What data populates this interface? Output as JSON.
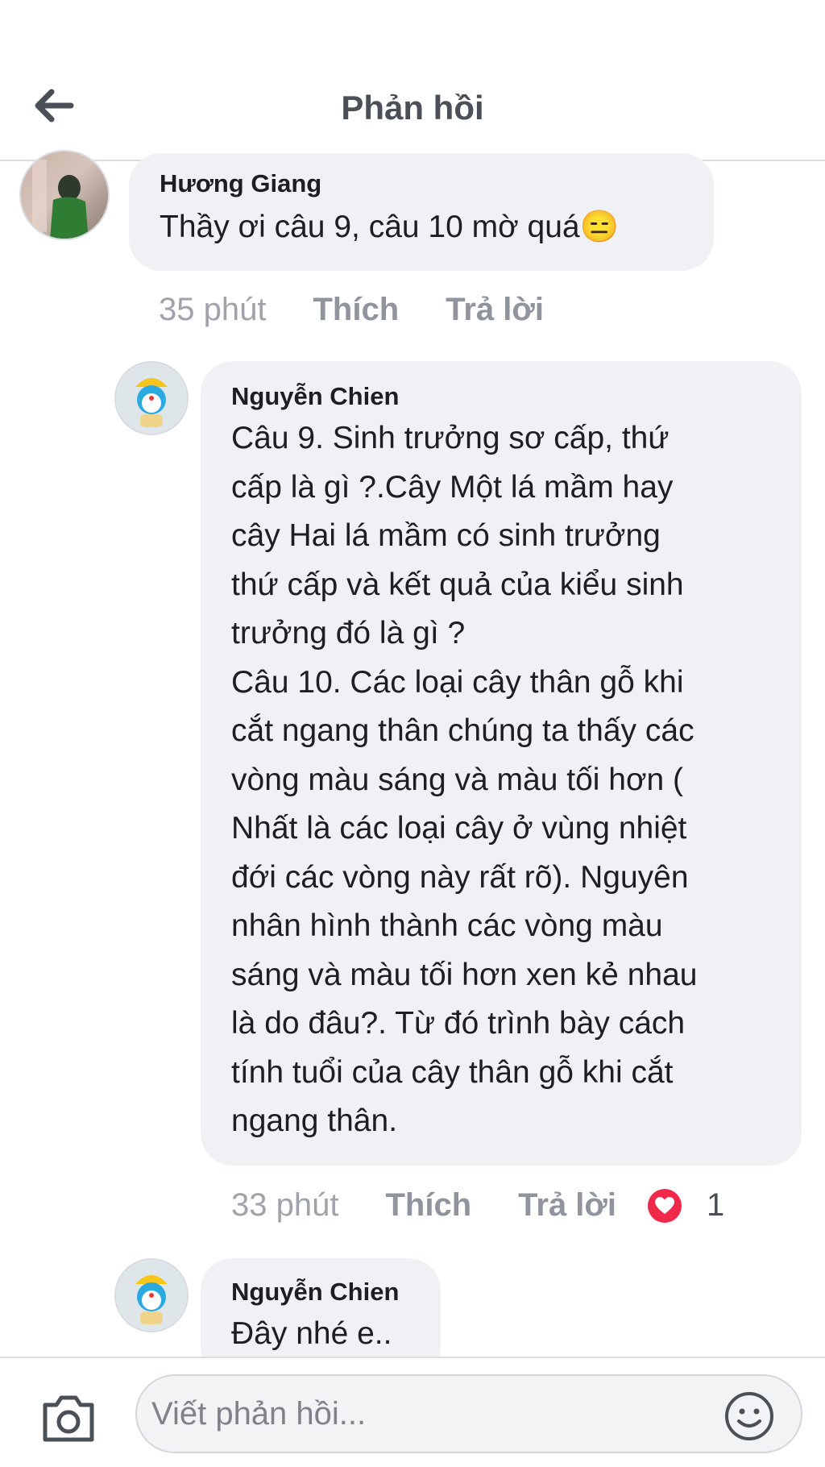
{
  "header": {
    "title": "Phản hồi",
    "back_icon": "arrow-left-icon"
  },
  "comments": [
    {
      "author": "Hương Giang",
      "text": "Thầy ơi câu 9, câu 10 mờ quá",
      "emoji": "😑",
      "time": "35 phút",
      "like_label": "Thích",
      "reply_label": "Trả lời"
    },
    {
      "author": "Nguyễn Chien",
      "text": "Câu 9. Sinh trưởng sơ cấp, thứ\ncấp là gì ?.Cây Một lá mầm hay\ncây Hai lá mầm có sinh trưởng\nthứ cấp và kết quả của kiểu sinh\ntrưởng đó là gì ?\nCâu 10. Các loại cây thân gỗ khi\ncắt ngang thân chúng ta thấy các\nvòng màu sáng và màu tối hơn (\nNhất là các loại cây ở vùng nhiệt\nđới các vòng này rất rõ). Nguyên\nnhân hình thành các vòng màu\nsáng và màu tối hơn xen kẻ nhau\nlà do đâu?. Từ đó trình bày cách\ntính tuổi của cây thân gỗ khi cắt\nngang thân.",
      "time": "33 phút",
      "like_label": "Thích",
      "reply_label": "Trả lời",
      "reaction_icon": "heart-icon",
      "reaction_count": "1"
    },
    {
      "author": "Nguyễn Chien",
      "text": "Đây nhé e.."
    }
  ],
  "composer": {
    "placeholder": "Viết phản hồi...",
    "camera_icon": "camera-icon",
    "emoji_icon": "smiley-icon"
  },
  "colors": {
    "bubble": "#f0f1f5",
    "meta_text": "#90949c",
    "heart": "#f0284a"
  }
}
